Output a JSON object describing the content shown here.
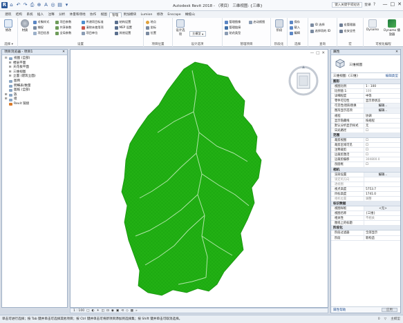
{
  "app": {
    "title": "Autodesk Revit 2018 -  （项目） 三维视图: {三维}",
    "title_right": [
      "键入关键字或短语",
      "登录"
    ],
    "window_buttons": [
      "—",
      "□",
      "✕"
    ]
  },
  "qat": [
    "R",
    "⌂",
    "↶",
    "↷",
    "⎙",
    "⊕",
    "A",
    "◎",
    "▤",
    "▾"
  ],
  "tabs": [
    "建筑",
    "结构",
    "系统",
    "插入",
    "注释",
    "分析",
    "体量和场地",
    "协作",
    "视图",
    "管理",
    "附加模块",
    "Lumion",
    "修改",
    "Enscape",
    "橄榄山"
  ],
  "active_tab": "管理",
  "ribbon": {
    "groups": [
      {
        "label": "选择 ▾",
        "big": "修改"
      },
      {
        "label": "设置",
        "items": [
          "材质",
          "对象样式",
          "捕捉",
          "项目信息",
          "项目参数",
          "共享参数",
          "全局参数",
          "传递项目标准",
          "清除未使用项",
          "项目单位",
          "结构设置",
          "MEP 设置",
          "其他设置"
        ]
      },
      {
        "label": "项目位置",
        "items": [
          "地点",
          "坐标",
          "位置"
        ]
      },
      {
        "label": "设计选项",
        "items": [
          "设计选项",
          "主模型"
        ]
      },
      {
        "label": "管理项目",
        "items": [
          "管理图像",
          "管理链接",
          "贴花类型",
          "启动视图"
        ]
      },
      {
        "label": "阶段化",
        "items": [
          "阶段"
        ]
      },
      {
        "label": "选择",
        "items": [
          "保存",
          "载入",
          "编辑"
        ]
      },
      {
        "label": "查询",
        "items": [
          "ID 选择",
          "选择项的 ID"
        ]
      },
      {
        "label": "宏",
        "items": [
          "宏管理器",
          "宏安全性"
        ]
      },
      {
        "label": "可视化编程",
        "items": [
          "Dynamo",
          "Dynamo 播放器"
        ]
      }
    ]
  },
  "browser": {
    "title": "项目浏览器 - 项目1",
    "nodes": [
      {
        "label": "视图 (全部)",
        "level": 0,
        "toggle": "⊟"
      },
      {
        "label": "楼层平面",
        "level": 1,
        "toggle": "⊞"
      },
      {
        "label": "天花板平面",
        "level": 1,
        "toggle": "⊞"
      },
      {
        "label": "三维视图",
        "level": 1,
        "toggle": "⊞"
      },
      {
        "label": "立面 (建筑立面)",
        "level": 1,
        "toggle": "⊞"
      },
      {
        "label": "图例",
        "level": 0,
        "toggle": ""
      },
      {
        "label": "明细表/数量",
        "level": 0,
        "toggle": ""
      },
      {
        "label": "图纸 (全部)",
        "level": 0,
        "toggle": ""
      },
      {
        "label": "族",
        "level": 0,
        "toggle": "⊞"
      },
      {
        "label": "组",
        "level": 0,
        "toggle": "⊞"
      },
      {
        "label": "Revit 链接",
        "level": 0,
        "toggle": ""
      }
    ]
  },
  "view": {
    "controls": [
      "—",
      "□",
      "✕"
    ],
    "terrain_color": "#22b014"
  },
  "viewbar": {
    "scale": "1 : 100",
    "icons": [
      "□",
      "◐",
      "☀",
      "◫",
      "⊡",
      "◉",
      "▣",
      "⟲",
      "◇",
      "▦",
      "»"
    ]
  },
  "properties": {
    "title": "属性",
    "type_name": "三维视图",
    "filter": "三维视图: {三维}",
    "edit_type": "编辑类型",
    "sections": [
      {
        "name": "图形",
        "rows": [
          [
            "视图比例",
            "1 : 100"
          ],
          [
            "比例值 1:",
            "100"
          ],
          [
            "详细程度",
            "中等"
          ],
          [
            "零件可见性",
            "显示原状态"
          ],
          [
            "可见性/图形替换",
            "编辑..."
          ],
          [
            "图形显示选项",
            "编辑..."
          ],
          [
            "规程",
            "协调"
          ],
          [
            "显示隐藏线",
            "按规程"
          ],
          [
            "默认分析显示样式",
            "无"
          ],
          [
            "日光路径",
            "☐"
          ]
        ]
      },
      {
        "name": "范围",
        "rows": [
          [
            "裁剪视图",
            "☐"
          ],
          [
            "裁剪区域可见",
            "☐"
          ],
          [
            "注释裁剪",
            "☐"
          ],
          [
            "远裁剪激活",
            "☐"
          ],
          [
            "远裁剪偏移",
            "304800.0"
          ],
          [
            "剖面框",
            "☐"
          ]
        ]
      },
      {
        "name": "相机",
        "rows": [
          [
            "渲染设置",
            "编辑..."
          ],
          [
            "锁定的方向",
            ""
          ],
          [
            "透视图",
            ""
          ],
          [
            "视点高度",
            "5753.7"
          ],
          [
            "目标高度",
            "1741.0"
          ],
          [
            "相机位置",
            "调整"
          ]
        ]
      },
      {
        "name": "标识数据",
        "rows": [
          [
            "视图样板",
            "<无>"
          ],
          [
            "视图名称",
            "{三维}"
          ],
          [
            "相关性",
            "不相关"
          ],
          [
            "图纸上的标题",
            ""
          ]
        ]
      },
      {
        "name": "阶段化",
        "rows": [
          [
            "阶段过滤器",
            "全部显示"
          ],
          [
            "阶段",
            "新构造"
          ]
        ]
      }
    ],
    "help": "属性帮助",
    "apply": "应用"
  },
  "status": {
    "text": "单击可进行选择；按 Tab 键并单击可选择其他项目；按 Ctrl 键并单击可将新项目添加到选择集；按 Shift 键并单击可取消选择。",
    "right": [
      "0",
      "▽",
      "主模型"
    ]
  }
}
